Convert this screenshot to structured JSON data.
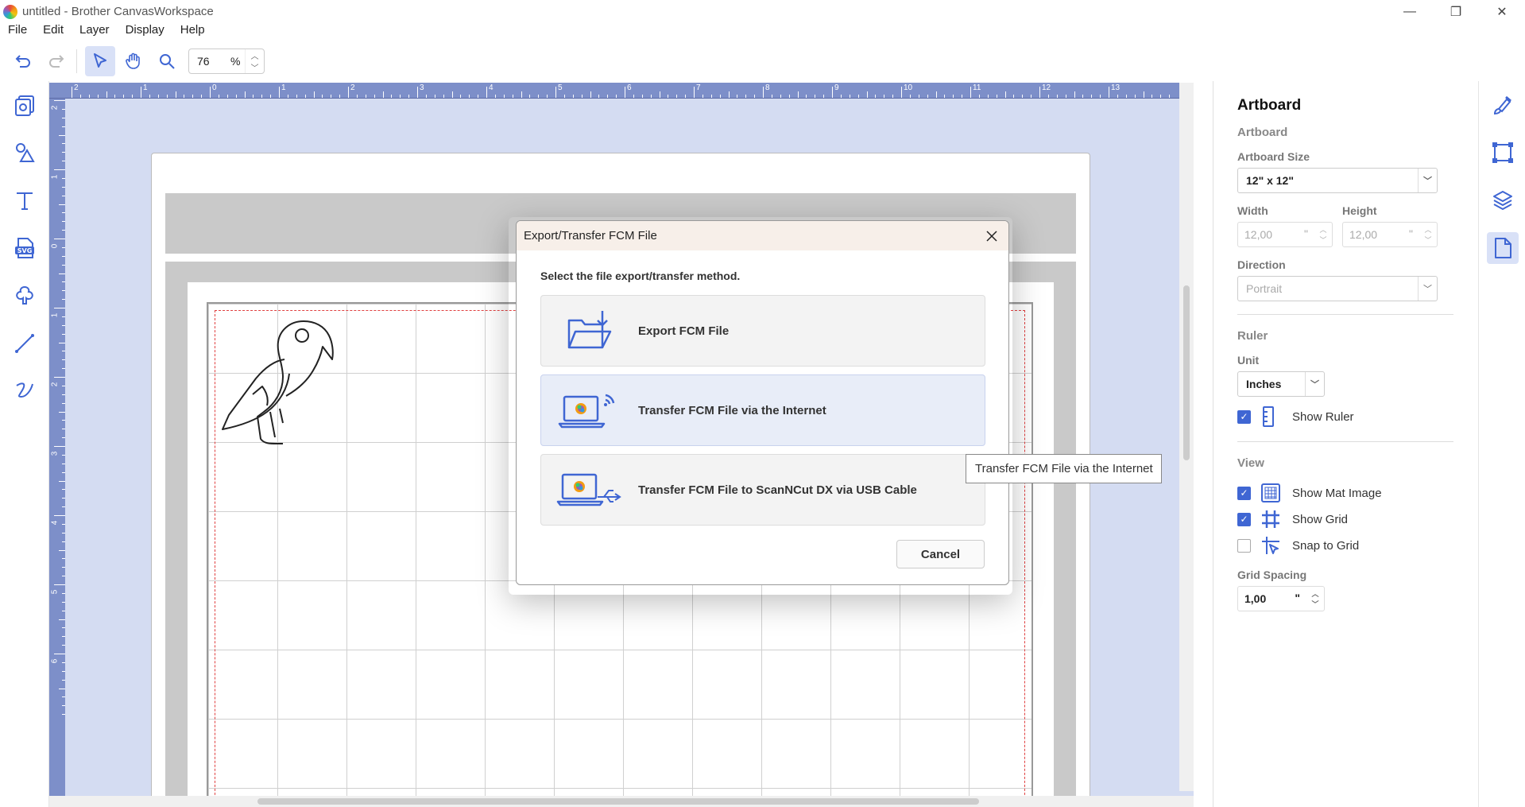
{
  "window": {
    "title": "untitled - Brother CanvasWorkspace",
    "minimize": "—",
    "restore": "❐",
    "close": "✕"
  },
  "menu": [
    "File",
    "Edit",
    "Layer",
    "Display",
    "Help"
  ],
  "toolbar": {
    "zoom_value": "76",
    "zoom_unit": "%"
  },
  "left_tools": [
    "project-icon",
    "shapes-icon",
    "text-icon",
    "svg-icon",
    "outline-icon",
    "line-icon",
    "freehand-icon"
  ],
  "ruler": {
    "top_labels": [
      "2",
      "1",
      "0",
      "1",
      "2",
      "3",
      "4",
      "5",
      "6",
      "7",
      "8",
      "9",
      "10",
      "11",
      "12",
      "13"
    ],
    "left_labels": [
      "2",
      "1",
      "0",
      "1",
      "2",
      "3",
      "4",
      "5",
      "6"
    ]
  },
  "dialog": {
    "title": "Export/Transfer FCM File",
    "instruction": "Select the file export/transfer method.",
    "options": [
      {
        "label": "Export FCM File",
        "icon": "folder-download-icon"
      },
      {
        "label": "Transfer FCM File via the Internet",
        "icon": "laptop-wireless-icon"
      },
      {
        "label": "Transfer FCM File to ScanNCut DX via USB Cable",
        "icon": "laptop-usb-icon"
      }
    ],
    "cancel": "Cancel"
  },
  "tooltip": "Transfer FCM File via the Internet",
  "panel": {
    "title": "Artboard",
    "section_artboard": "Artboard",
    "artboard_size_label": "Artboard Size",
    "artboard_size_value": "12\" x 12\"",
    "width_label": "Width",
    "width_value": "12,00",
    "height_label": "Height",
    "height_value": "12,00",
    "unit_mark": "\"",
    "direction_label": "Direction",
    "direction_value": "Portrait",
    "section_ruler": "Ruler",
    "unit_label": "Unit",
    "unit_value": "Inches",
    "show_ruler": "Show Ruler",
    "section_view": "View",
    "show_mat_image": "Show Mat Image",
    "show_grid": "Show Grid",
    "snap_to_grid": "Snap to Grid",
    "grid_spacing_label": "Grid Spacing",
    "grid_spacing_value": "1,00"
  },
  "colors": {
    "accent": "#3f66d3",
    "canvas_bg": "#d4dcf2",
    "ruler": "#7d8fc9"
  }
}
